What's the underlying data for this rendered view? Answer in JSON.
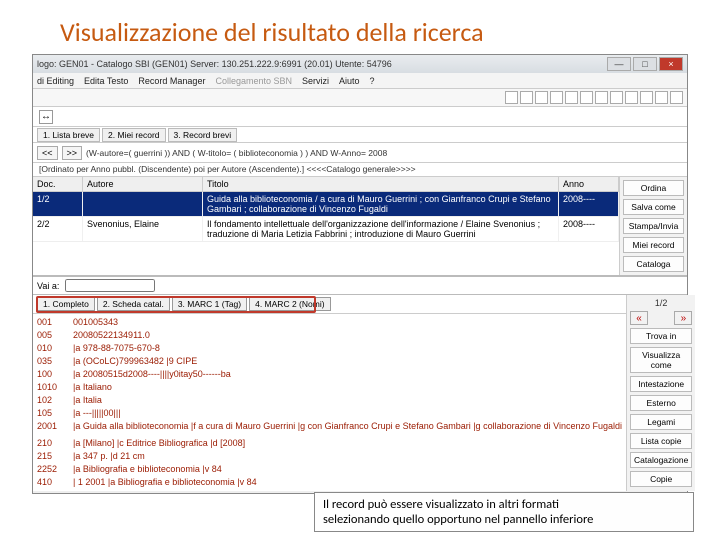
{
  "slide": {
    "title": "Visualizzazione del risultato della ricerca"
  },
  "window": {
    "title": "logo: GEN01 - Catalogo SBI (GEN01)  Server: 130.251.222.9:6991 (20.01)  Utente: 54796"
  },
  "menubar": {
    "editing": "di Editing",
    "editaTesto": "Edita Testo",
    "recordManager": "Record Manager",
    "collegamentoSBN": "Collegamento SBN",
    "servizi": "Servizi",
    "aiuto": "Aiuto",
    "help": "?"
  },
  "tabs": {
    "t1": "1. Lista breve",
    "t2": "2. Miei record",
    "t3": "3. Record brevi"
  },
  "nav": {
    "prev": "<<",
    "next": ">>",
    "query": "(W-autore=( guerrini )) AND ( W-titolo= ( biblioteconomia ) ) AND W-Anno= 2008"
  },
  "sort": {
    "text": "[Ordinato per Anno pubbl. (Discendente) poi per Autore (Ascendente).]   <<<<Catalogo generale>>>>"
  },
  "results": {
    "headers": {
      "doc": "Doc.",
      "autore": "Autore",
      "titolo": "Titolo",
      "anno": "Anno"
    },
    "rows": [
      {
        "doc": "1/2",
        "autore": "",
        "titolo": "Guida alla biblioteconomia / a cura di Mauro Guerrini ; con Gianfranco Crupi e Stefano Gambari ; collaborazione di Vincenzo Fugaldi",
        "anno": "2008----"
      },
      {
        "doc": "2/2",
        "autore": "Svenonius, Elaine",
        "titolo": "Il fondamento intellettuale dell'organizzazione dell'informazione / Elaine Svenonius ; traduzione di Maria Letizia Fabbrini ; introduzione di Mauro Guerrini",
        "anno": "2008----"
      }
    ]
  },
  "sidebuttons": {
    "ordina": "Ordina",
    "salva": "Salva come",
    "stampa": "Stampa/Invia",
    "miei": "Miei record",
    "cataloga": "Cataloga"
  },
  "vai": {
    "label": "Vai a:"
  },
  "recTabs": {
    "t1": "1. Completo",
    "t2": "2. Scheda catal.",
    "t3": "3. MARC 1 (Tag)",
    "t4": "4. MARC 2 (Nomi)"
  },
  "marc": [
    {
      "tag": "001",
      "val": "001005343"
    },
    {
      "tag": "005",
      "val": "20080522134911.0"
    },
    {
      "tag": "010",
      "val": "|a 978-88-7075-670-8"
    },
    {
      "tag": "035",
      "val": "|a (OCoLC)799963482 |9 CIPE"
    },
    {
      "tag": "100",
      "val": "|a 20080515d2008----||||y0itay50------ba"
    },
    {
      "tag": "1010",
      "val": "|a Italiano"
    },
    {
      "tag": "102",
      "val": "|a Italia"
    },
    {
      "tag": "105",
      "val": "|a ---|||||00|||"
    },
    {
      "tag": "2001",
      "val": "|a Guida alla biblioteconomia |f a cura di Mauro Guerrini |g con Gianfranco Crupi e Stefano Gambari |g collaborazione di Vincenzo Fugaldi"
    },
    {
      "tag": "",
      "val": ""
    },
    {
      "tag": "210",
      "val": "|a [Milano] |c Editrice Bibliografica |d [2008]"
    },
    {
      "tag": "215",
      "val": "|a 347 p. |d 21 cm"
    },
    {
      "tag": "2252",
      "val": "|a Bibliografia e biblioteconomia |v 84"
    },
    {
      "tag": "410",
      "val": "| 1 2001 |a Bibliografia e biblioteconomia |v 84"
    }
  ],
  "side2": {
    "idx": "1/2",
    "trova": "Trova in",
    "visual": "Visualizza come",
    "intest": "Intestazione",
    "esterno": "Esterno",
    "legami": "Legami",
    "copie": "Lista copie",
    "catalog": "Catalogazione",
    "copieBtn": "Copie"
  },
  "callout": {
    "line1": "Il record può essere visualizzato in altri formati",
    "line2": "selezionando quello opportuno nel pannello inferiore"
  }
}
